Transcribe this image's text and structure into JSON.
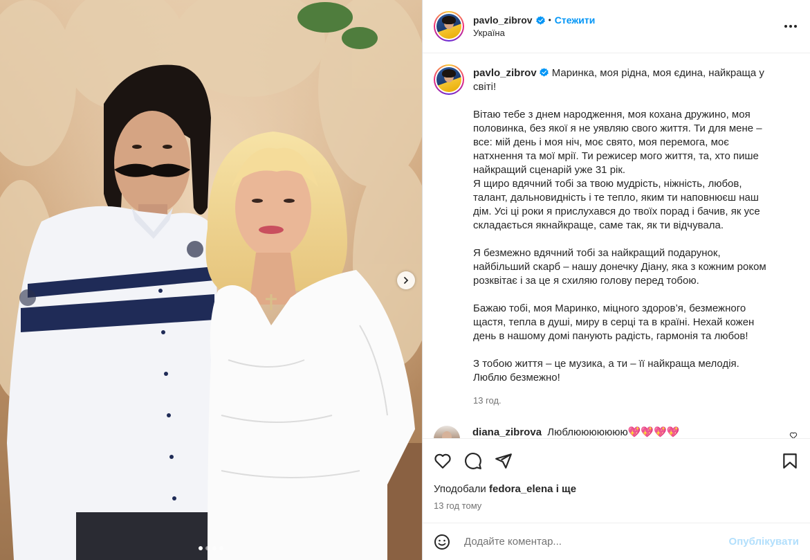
{
  "post": {
    "username": "pavlo_zibrov",
    "separator": "•",
    "follow_label": "Стежити",
    "location": "Україна",
    "more_icon": "more-horizontal-icon"
  },
  "caption": {
    "username": "pavlo_zibrov",
    "first_line": "Маринка, моя рідна, моя єдина, найкраща у світі!",
    "para1": "Вітаю тебе з днем народження, моя кохана дружино, моя половинка, без якої я не уявляю свого життя. Ти для мене – все: мій день і моя ніч, моє свято, моя перемога, моє натхнення та мої мрії. Ти режисер мого життя, та, хто пише найкращий сценарій уже 31 рік.\nЯ щиро вдячний тобі за твою мудрість, ніжність, любов, талант, дальновидність і те тепло, яким ти наповнюєш наш дім. Усі ці роки я прислухався до твоїх порад і бачив, як усе складається якнайкраще, саме так, як ти відчувала.",
    "para2": "Я безмежно вдячний тобі за найкращий подарунок, найбільший скарб – нашу донечку Діану, яка з кожним роком розквітає і за це я схиляю голову перед тобою.",
    "para3": "Бажаю тобі, моя Маринко, міцного здоров’я, безмежного щастя, тепла в душі, миру в серці та в країні. Нехай кожен день в нашому домі панують радість, гармонія та любов!",
    "para4": "З тобою життя – це музика, а ти – її найкраща мелодія.\nЛюблю безмежно!",
    "time_ago": "13 год."
  },
  "comment": {
    "username": "diana_zibrova",
    "text": "Люблююююююю💖💖💖💖"
  },
  "actions": {
    "like_icon": "heart-icon",
    "comment_icon": "comment-icon",
    "share_icon": "share-icon",
    "save_icon": "bookmark-icon",
    "likes_prefix": "Уподобали",
    "likes_user": "fedora_elena",
    "likes_suffix": "і ще",
    "posted_time": "13 год тому"
  },
  "comment_input": {
    "placeholder": "Додайте коментар...",
    "publish_label": "Опублікувати",
    "emoji_icon": "emoji-icon"
  },
  "carousel": {
    "slide_count": 4,
    "active_index": 0
  },
  "colors": {
    "accent": "#0095f6",
    "publish_disabled": "#b2dffc",
    "verified": "#0095f6",
    "heart": "#ed4956"
  }
}
